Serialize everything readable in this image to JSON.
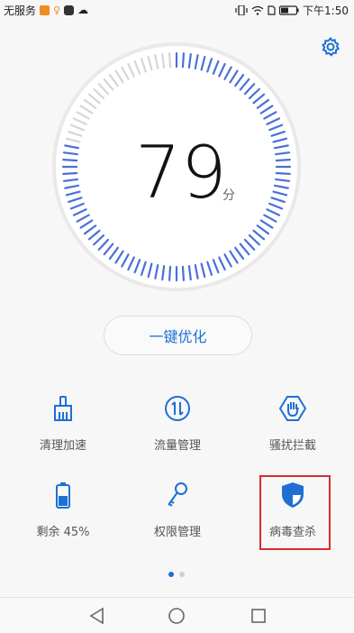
{
  "status_bar": {
    "carrier": "无服务",
    "time": "下午1:50"
  },
  "score": {
    "value": "79",
    "unit": "分",
    "level_percent": 79
  },
  "optimize_button": {
    "label": "一键优化"
  },
  "tools": [
    {
      "label": "清理加速",
      "icon": "broom-icon"
    },
    {
      "label": "流量管理",
      "icon": "data-traffic-icon"
    },
    {
      "label": "骚扰拦截",
      "icon": "hand-block-icon"
    },
    {
      "label": "剩余 45%",
      "icon": "battery-icon"
    },
    {
      "label": "权限管理",
      "icon": "key-icon"
    },
    {
      "label": "病毒查杀",
      "icon": "shield-icon"
    }
  ],
  "pager": {
    "pages": 2,
    "current": 1
  },
  "colors": {
    "accent": "#1e6fd2",
    "gauge_active": "#4b6fd9",
    "gauge_inactive": "#d6d6d6",
    "highlight": "#d32f2f"
  }
}
